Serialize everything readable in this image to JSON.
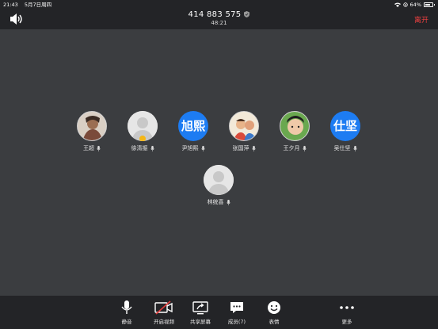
{
  "status_bar": {
    "time": "21:43",
    "date": "5月7日周四",
    "battery": "64%"
  },
  "header": {
    "meeting_id": "414 883 575",
    "elapsed": "48:21",
    "leave_label": "离开"
  },
  "participants": [
    {
      "name": "王超",
      "avatar": "photo"
    },
    {
      "name": "徐清振",
      "avatar": "default",
      "host": true
    },
    {
      "name": "尹旭熙",
      "avatar": "text",
      "avatar_text": "旭熙"
    },
    {
      "name": "张国萍",
      "avatar": "photo"
    },
    {
      "name": "王夕月",
      "avatar": "photo"
    },
    {
      "name": "吴仕坚",
      "avatar": "text",
      "avatar_text": "仕坚"
    },
    {
      "name": "林统喜",
      "avatar": "default"
    }
  ],
  "toolbar": {
    "mute": "静音",
    "start_video": "开启视频",
    "share_screen": "共享屏幕",
    "members": "成员(7)",
    "reactions": "表情",
    "more": "更多"
  },
  "colors": {
    "background": "#3b3d40",
    "bar": "#232427",
    "accent": "#1d7cf2",
    "leave": "#f04040"
  }
}
